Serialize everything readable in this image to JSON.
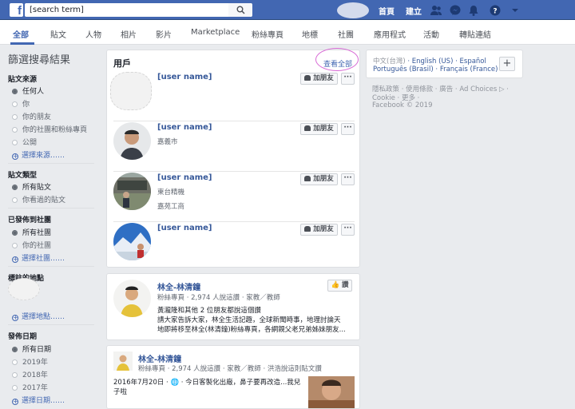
{
  "topbar": {
    "logo": "f",
    "search_value": "[search term]",
    "home_label": "首頁",
    "create_label": "建立"
  },
  "filters": {
    "tabs": [
      {
        "label": "全部"
      },
      {
        "label": "貼文"
      },
      {
        "label": "人物"
      },
      {
        "label": "相片"
      },
      {
        "label": "影片"
      },
      {
        "label": "Marketplace"
      },
      {
        "label": "粉絲專頁"
      },
      {
        "label": "地標"
      },
      {
        "label": "社團"
      },
      {
        "label": "應用程式"
      },
      {
        "label": "活動"
      },
      {
        "label": "轉貼連結"
      }
    ]
  },
  "sidebar": {
    "title": "篩選搜尋結果",
    "sections": [
      {
        "heading": "貼文來源",
        "options": [
          "任何人",
          "你",
          "你的朋友",
          "你的社團和粉絲專頁",
          "公開"
        ],
        "link": "選擇來源……"
      },
      {
        "heading": "貼文類型",
        "options": [
          "所有貼文",
          "你看過的貼文"
        ]
      },
      {
        "heading": "已發佈到社團",
        "options": [
          "所有社團",
          "你的社團"
        ],
        "link": "選擇社團……"
      },
      {
        "heading": "標註的地點",
        "link": "選擇地點……"
      },
      {
        "heading": "發佈日期",
        "options": [
          "所有日期",
          "2019年",
          "2018年",
          "2017年"
        ],
        "link": "選擇日期……"
      }
    ]
  },
  "users_card": {
    "title": "用戶",
    "see_all": "查看全部",
    "add_friend": "加朋友",
    "more": "···",
    "rows": [
      {
        "name": "[user name]",
        "sub1": "",
        "sub2": ""
      },
      {
        "name": "[user name]",
        "sub1": "嘉義市",
        "sub2": ""
      },
      {
        "name": "[user name]",
        "sub1": "東台精機",
        "sub2": "嘉苑工商"
      },
      {
        "name": "[user name]",
        "sub1": "",
        "sub2": ""
      }
    ]
  },
  "page_card": {
    "name": "林全-林清鐘",
    "meta": "粉絲專頁 · 2,974 人說這讚 · 家教／教師",
    "like": "讚",
    "body": [
      "黃瀧隆和其他 2 位朋友都說這個讚",
      "請大家告訴大家，林全生活記趣，全球新聞時事，地理討論天",
      "地即將移至林全(林清鐘)粉絲專頁，各網親父老兄弟姊妹朋友..."
    ]
  },
  "post_card": {
    "name": "林全-林清鐘",
    "meta": "粉絲專頁 · 2,974 人說這讚 · 家教／教師 · 洪浩說這則貼文讚",
    "date": "2016年7月20日 · ",
    "body": [
      "今日客製化出廠，鼻子要再改造...我兒",
      "子啦"
    ]
  },
  "right": {
    "languages_line1": [
      "中文(台灣)",
      "English (US)",
      "Español"
    ],
    "languages_line2": [
      "Português (Brasil)",
      "Français (France)"
    ],
    "footer1": "隱私政策 · 使用條款 · 廣告 · Ad Choices ▷ ·",
    "footer2": "Cookie · 更多 ·",
    "footer3": "Facebook © 2019"
  },
  "colors": {
    "brand": "#4267b2",
    "link": "#365899",
    "highlight_ring": "#d86ad5"
  }
}
